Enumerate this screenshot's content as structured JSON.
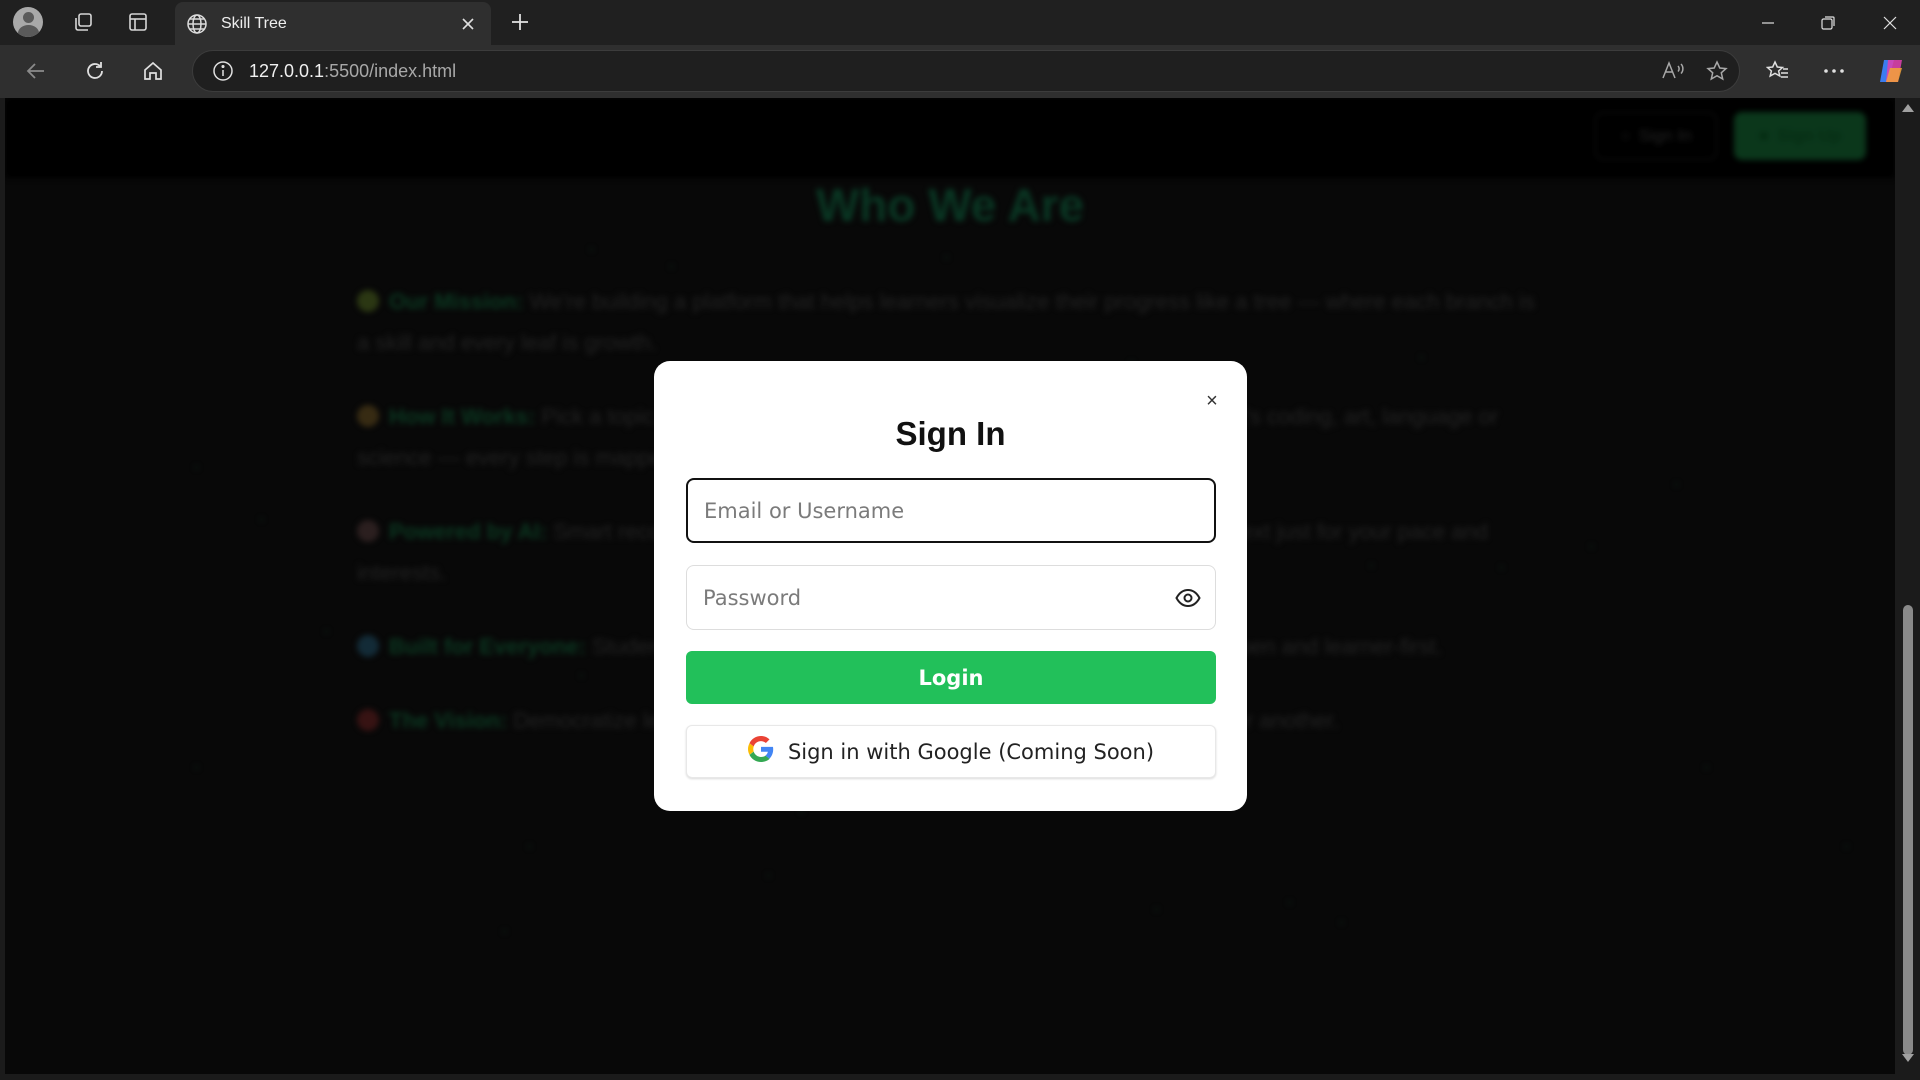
{
  "browser": {
    "tab_title": "Skill Tree",
    "url_host": "127.0.0.1",
    "url_path": ":5500/index.html"
  },
  "page": {
    "nav": {
      "signin_label": "Sign In",
      "signup_label": "Sign Up"
    },
    "heading": "Who We Are",
    "paragraphs": [
      {
        "key": "Our Mission:",
        "text": "We're building a platform that helps learners visualize their progress like a tree — where each branch is a skill and every leaf is growth.",
        "emoji_color": "#3a4a1a"
      },
      {
        "key": "How It Works:",
        "text": "Pick a topic, follow the path, and watch your skills branch out. Whether it's coding, art, language or science — every step is mapped.",
        "emoji_color": "#4a3a1a"
      },
      {
        "key": "Powered by AI:",
        "text": "Smart recommendations adapt your learning path, suggesting what's next just for your pace and interests.",
        "emoji_color": "#3a2a2a"
      },
      {
        "key": "Built for Everyone:",
        "text": "Students, self-learners, and professionals alike — the platform is open and learner-first.",
        "emoji_color": "#1a3a4a"
      },
      {
        "key": "The Vision:",
        "text": "Democratize learning by helping everyone grow their skills, one branch after another.",
        "emoji_color": "#4a1a1a"
      }
    ]
  },
  "modal": {
    "title": "Sign In",
    "close_symbol": "×",
    "email_placeholder": "Email or Username",
    "password_placeholder": "Password",
    "login_label": "Login",
    "google_label": "Sign in with Google (Coming Soon)"
  },
  "colors": {
    "accent_green": "#22c05a",
    "modal_bg": "#ffffff"
  }
}
